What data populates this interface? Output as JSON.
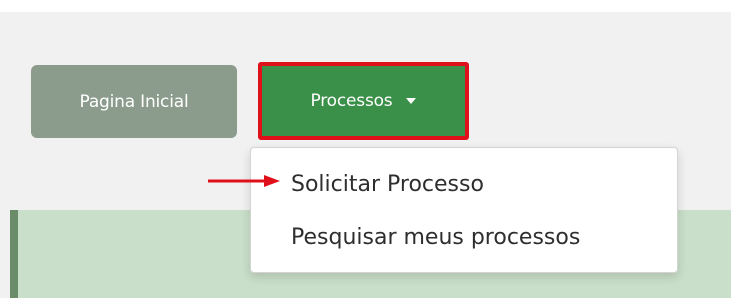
{
  "nav": {
    "home_label": "Pagina Inicial",
    "processos_label": "Processos"
  },
  "dropdown": {
    "items": [
      {
        "label": "Solicitar Processo"
      },
      {
        "label": "Pesquisar meus processos"
      }
    ]
  },
  "colors": {
    "home_button": "#8c9c8c",
    "processos_button": "#3a8f49",
    "highlight_border": "#e0101a",
    "annotation_arrow": "#e0101a",
    "content_panel": "#c9dfc9"
  },
  "icons": {
    "dropdown_caret": "caret-down-icon",
    "annotation": "red-arrow-icon"
  }
}
